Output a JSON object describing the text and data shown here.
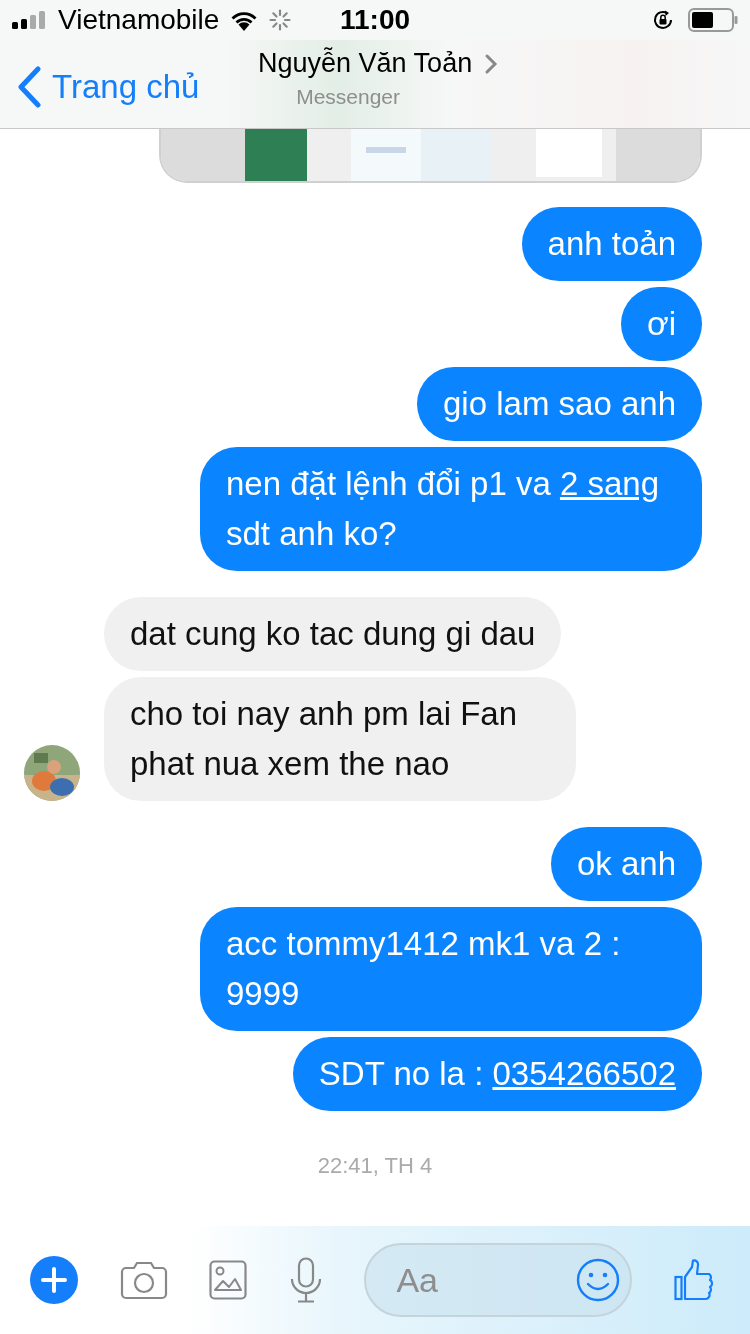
{
  "status_bar": {
    "carrier": "Vietnamobile",
    "time": "11:00"
  },
  "header": {
    "back_label": "Trang chủ",
    "title": "Nguyễn Văn Toản",
    "subtitle": "Messenger"
  },
  "messages": [
    {
      "kind": "sent",
      "parts": [
        {
          "text": "anh toản",
          "link": false
        }
      ]
    },
    {
      "kind": "sent",
      "parts": [
        {
          "text": "ơi",
          "link": false
        }
      ]
    },
    {
      "kind": "sent",
      "parts": [
        {
          "text": "gio lam sao anh",
          "link": false
        }
      ]
    },
    {
      "kind": "sent",
      "parts": [
        {
          "text": "nen đặt lệnh đổi p1 va ",
          "link": false
        },
        {
          "text": "2 sang",
          "link": true
        },
        {
          "text": " sdt anh ko?",
          "link": false
        }
      ]
    },
    {
      "kind": "received",
      "parts": [
        {
          "text": "dat cung ko tac dung gi dau",
          "link": false
        }
      ]
    },
    {
      "kind": "received",
      "parts": [
        {
          "text": "cho toi nay anh pm lai Fan phat nua xem the nao",
          "link": false
        }
      ]
    },
    {
      "kind": "sent",
      "parts": [
        {
          "text": "ok anh",
          "link": false
        }
      ]
    },
    {
      "kind": "sent",
      "parts": [
        {
          "text": "acc tommy1412 mk1 va 2 : 9999",
          "link": false
        }
      ]
    },
    {
      "kind": "sent",
      "parts": [
        {
          "text": "SDT no la :  ",
          "link": false
        },
        {
          "text": "0354266502",
          "link": true
        }
      ]
    }
  ],
  "timestamp": "22:41, TH 4",
  "composer": {
    "placeholder": "Aa"
  }
}
